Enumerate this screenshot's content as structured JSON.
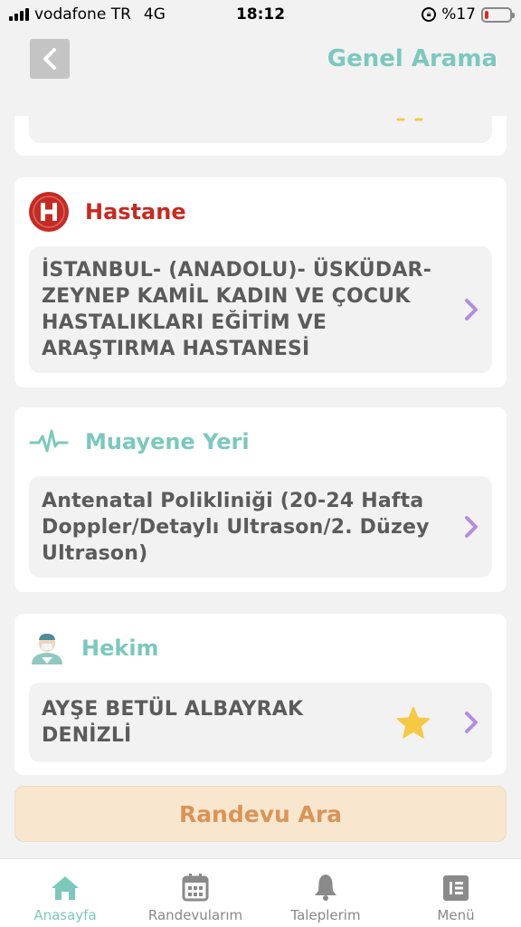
{
  "status_bar": {
    "carrier": "vodafone TR",
    "network": "4G",
    "time": "18:12",
    "battery": "%17",
    "battery_level": 0.17
  },
  "header": {
    "title": "Genel Arama"
  },
  "hospital": {
    "title": "Hastane",
    "icon_letter": "H",
    "value": "İSTANBUL- (ANADOLU)- ÜSKÜDAR- ZEYNEP KAMİL KADIN VE ÇOCUK HASTALIKLARI EĞİTİM VE ARAŞTIRMA HASTANESİ"
  },
  "clinic": {
    "title": "Muayene Yeri",
    "value": "Antenatal Polikliniği (20-24 Hafta Doppler/Detaylı Ultrason/2. Düzey Ultrason)"
  },
  "doctor": {
    "title": "Hekim",
    "value": "AYŞE BETÜL ALBAYRAK DENİZLİ"
  },
  "search_button": {
    "label": "Randevu Ara"
  },
  "tabs": [
    {
      "label": "Anasayfa",
      "active": true
    },
    {
      "label": "Randevularım",
      "active": false
    },
    {
      "label": "Taleplerim",
      "active": false
    },
    {
      "label": "Menü",
      "active": false
    }
  ],
  "colors": {
    "accent": "#7cc8bd",
    "hospital_red": "#c62a22",
    "chevron": "#b48de0",
    "star": "#f6c944",
    "search_bg": "#f8e6cf",
    "search_text": "#d99556"
  }
}
